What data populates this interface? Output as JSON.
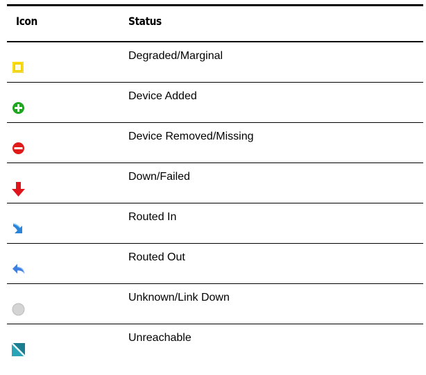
{
  "table": {
    "headers": {
      "icon": "Icon",
      "status": "Status"
    },
    "rows": [
      {
        "icon": "degraded-marginal-icon",
        "status": "Degraded/Marginal"
      },
      {
        "icon": "device-added-icon",
        "status": "Device Added"
      },
      {
        "icon": "device-removed-icon",
        "status": "Device Removed/Missing"
      },
      {
        "icon": "down-failed-icon",
        "status": "Down/Failed"
      },
      {
        "icon": "routed-in-icon",
        "status": "Routed In"
      },
      {
        "icon": "routed-out-icon",
        "status": "Routed Out"
      },
      {
        "icon": "unknown-link-down-icon",
        "status": "Unknown/Link Down"
      },
      {
        "icon": "unreachable-icon",
        "status": "Unreachable"
      }
    ]
  },
  "colors": {
    "degraded": "#f5d300",
    "added": "#1fa51f",
    "removed": "#e01919",
    "down": "#e0141b",
    "routed_in": "#2b84d8",
    "routed_out": "#3f7fe0",
    "unknown": "#d4d4d4",
    "unreachable": "#1a7d90"
  }
}
